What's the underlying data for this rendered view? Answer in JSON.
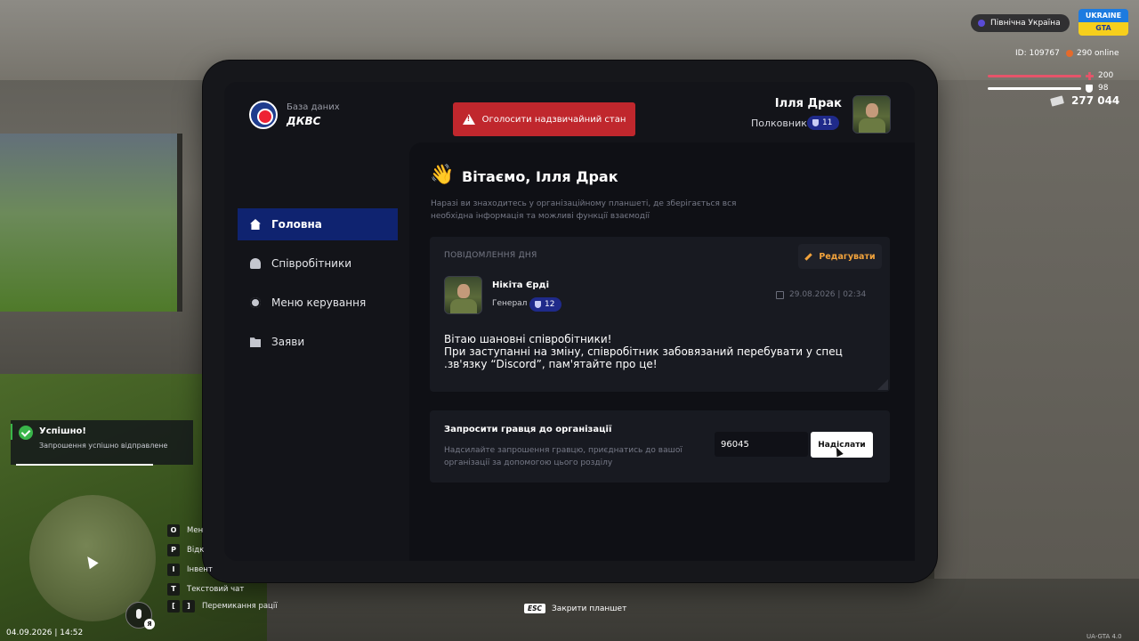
{
  "header": {
    "db_subtitle": "База даних",
    "db_title": "ДКВС",
    "emergency_button": "Оголосити надзвичайний стан",
    "user_name": "Ілля Драк",
    "user_rank": "Полковник",
    "user_rank_level": "11"
  },
  "sidebar": {
    "items": [
      {
        "label": "Головна",
        "icon": "home-icon",
        "active": true
      },
      {
        "label": "Співробітники",
        "icon": "users-icon"
      },
      {
        "label": "Меню керування",
        "icon": "gear-icon"
      },
      {
        "label": "Заяви",
        "icon": "folder-icon"
      }
    ]
  },
  "greeting": {
    "icon": "👋",
    "title": "Вітаємо, Ілля Драк",
    "description": "Наразі ви знаходитесь у організаційному планшеті, де зберігається вся необхідна інформація та можливі функції взаємодії"
  },
  "motd": {
    "label": "ПОВІДОМЛЕННЯ ДНЯ",
    "edit_button": "Редагувати",
    "author_name": "Нікіта Єрді",
    "author_rank": "Генерал",
    "author_rank_level": "12",
    "date": "29.08.2026 | 02:34",
    "text": "Вітаю шановні співробітники!\nПри заступанні на зміну, співробітник забовязаний перебувати у спец\n.зв'язку “Discord”, пам'ятайте про це!"
  },
  "invite": {
    "title": "Запросити гравця до організації",
    "description": "Надсилайте запрошення гравцю, приєднатись до вашої організації за допомогою цього розділу",
    "input_value": "96045",
    "send_button": "Надіслати"
  },
  "hud": {
    "server_name": "Північна Україна",
    "brand_top": "UKRAINE",
    "brand_bottom": "GTA",
    "player_id": "ID: 109767",
    "online": "290 online",
    "health": "200",
    "armor": "98",
    "money": "277 044",
    "datetime": "04.09.2026 | 14:52",
    "mic_key": "Я",
    "version": "UA-GTA 4.0",
    "colors": {
      "health": "#e6546a",
      "accent": "#0f2370",
      "emergency": "#c0272d",
      "edit": "#f2a33c"
    }
  },
  "toast": {
    "title": "Успішно!",
    "text": "Запрошення успішно відправлене",
    "progress": 0.75
  },
  "hotkeys": [
    {
      "keys": [
        "O"
      ],
      "label": "Мен"
    },
    {
      "keys": [
        "P"
      ],
      "label": "Відк"
    },
    {
      "keys": [
        "I"
      ],
      "label": "Інвент"
    },
    {
      "keys": [
        "T"
      ],
      "label": "Текстовий чат"
    },
    {
      "keys": [
        "[",
        "]"
      ],
      "label": "Перемикання рації"
    }
  ],
  "esc_hint": {
    "key": "ESC",
    "label": "Закрити планшет"
  }
}
